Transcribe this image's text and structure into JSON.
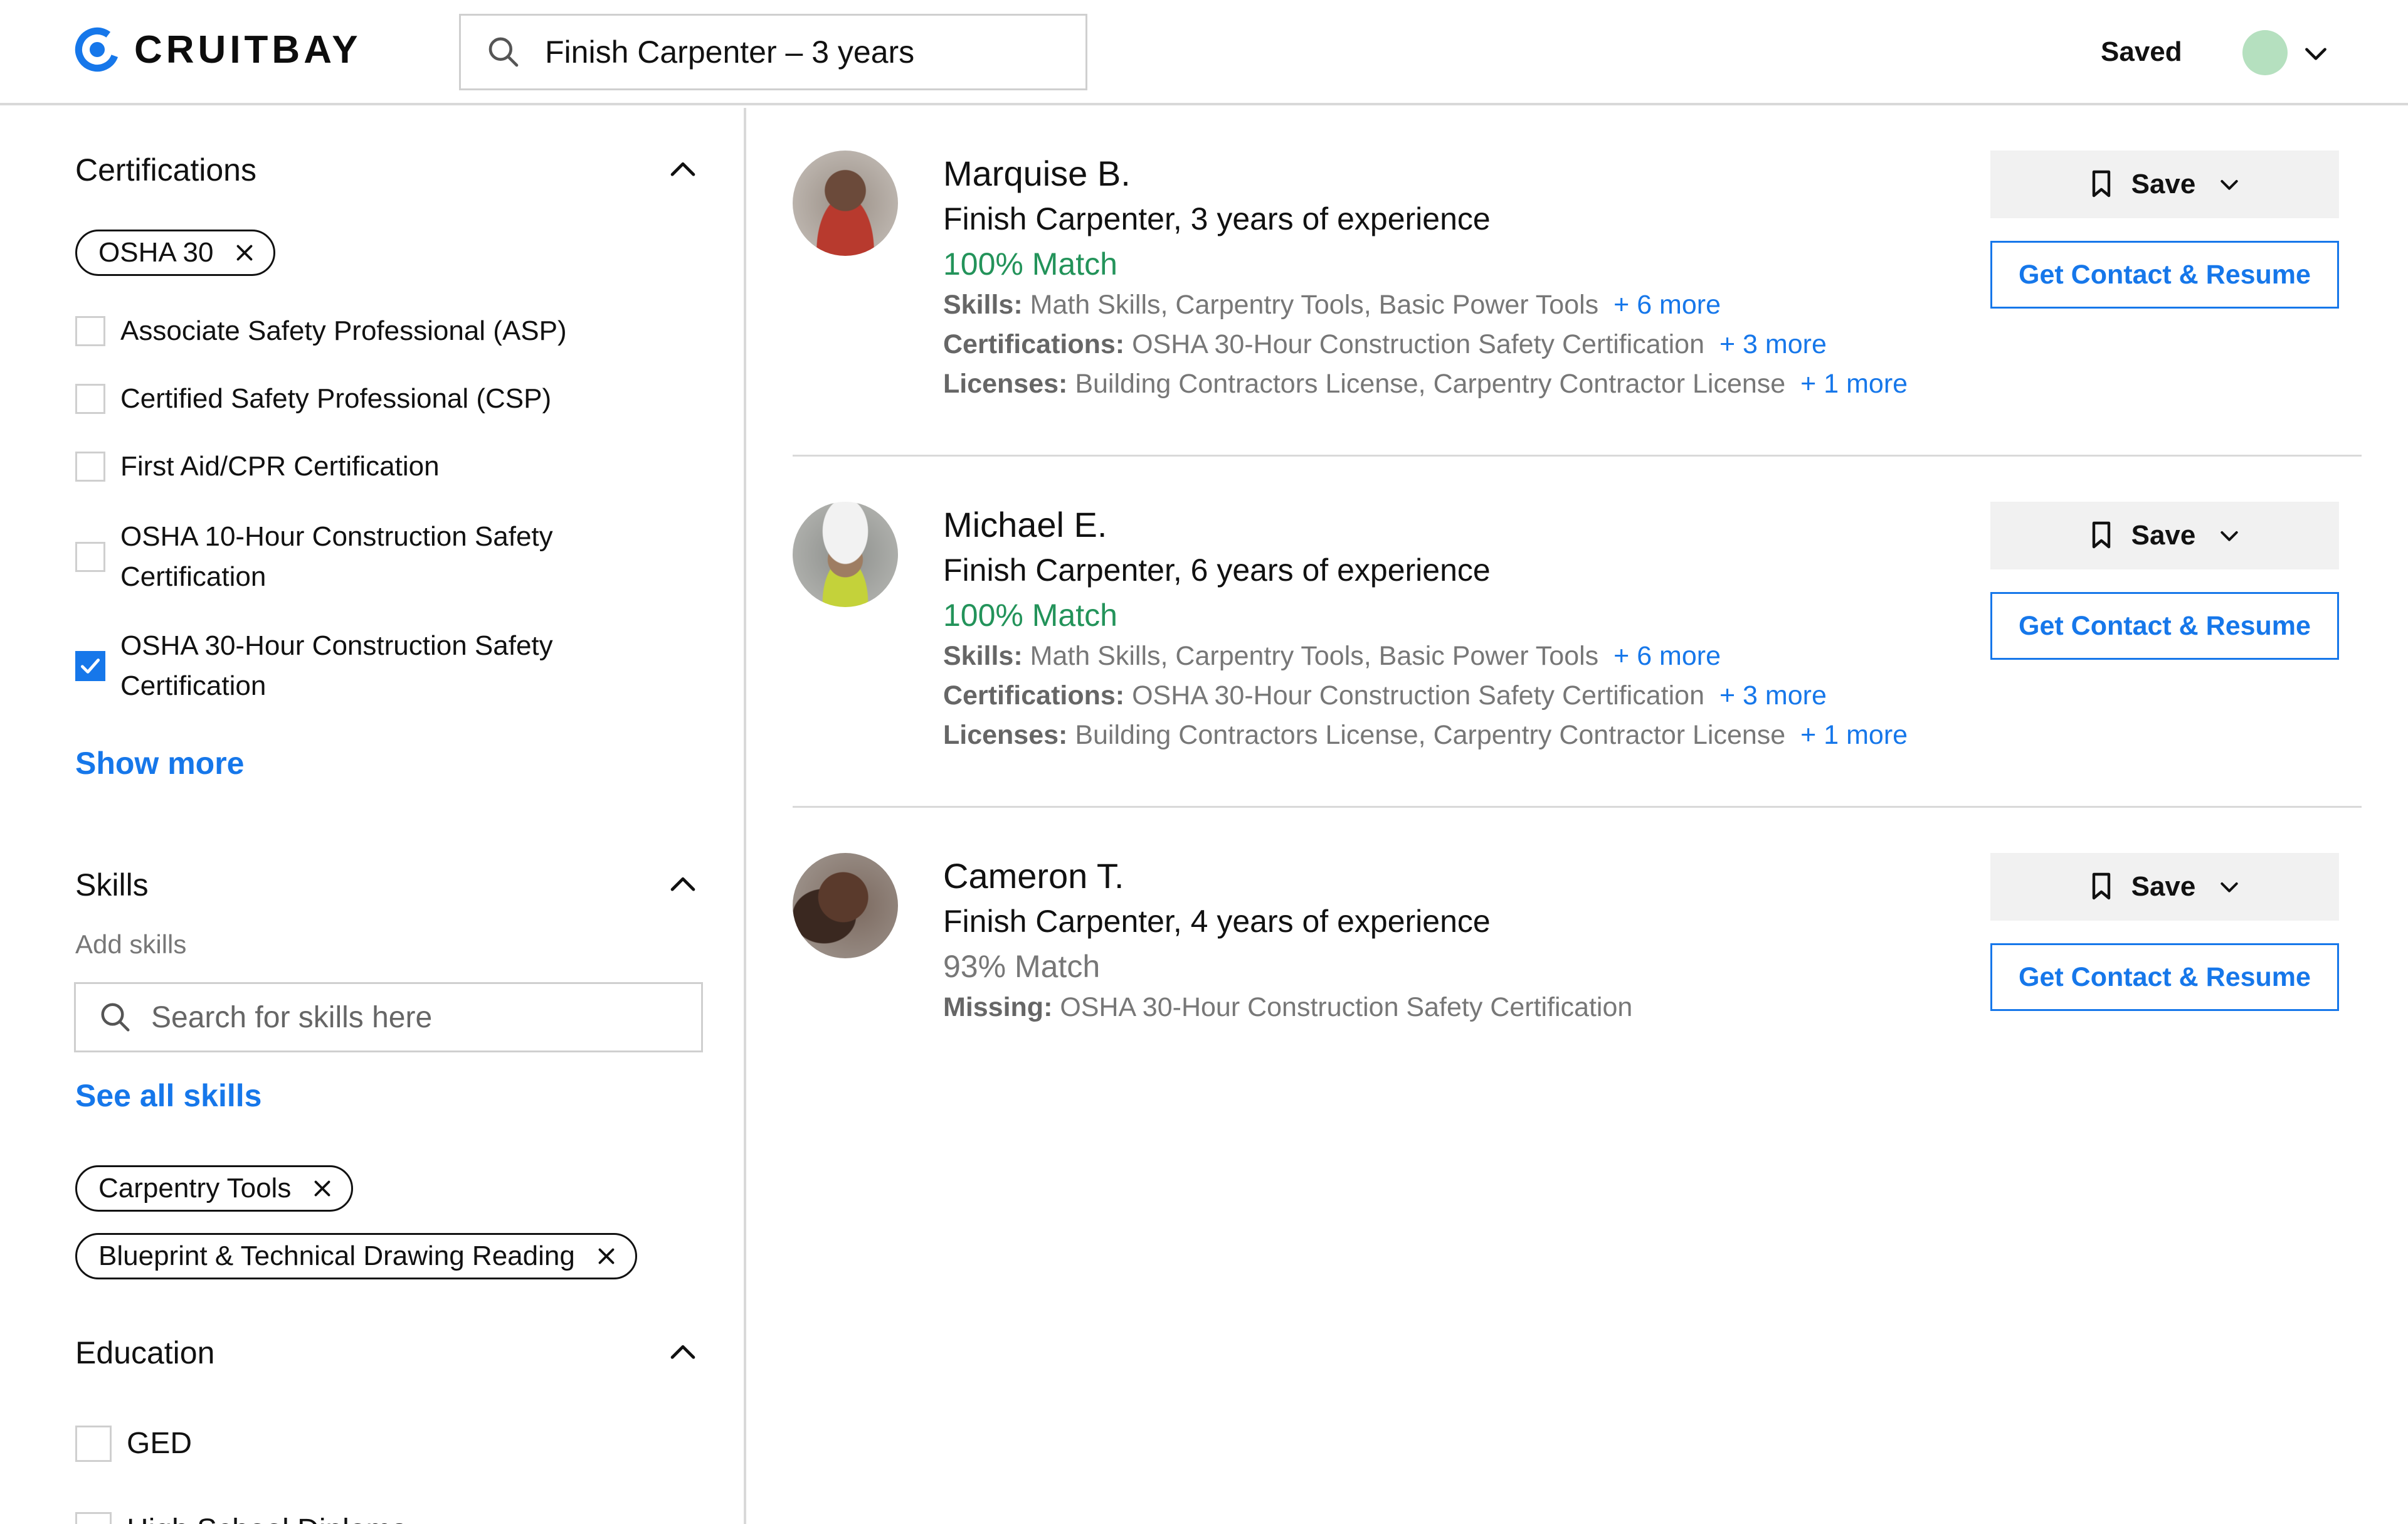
{
  "header": {
    "brand": "CRUITBAY",
    "search_value": "Finish Carpenter – 3 years",
    "saved_label": "Saved",
    "avatar_color": "#b5e0bf"
  },
  "sidebar": {
    "certifications": {
      "title": "Certifications",
      "chips": [
        "OSHA 30"
      ],
      "options": [
        {
          "label": "Associate Safety Professional (ASP)",
          "checked": false
        },
        {
          "label": "Certified Safety Professional (CSP)",
          "checked": false
        },
        {
          "label": "First Aid/CPR Certification",
          "checked": false
        },
        {
          "label": "OSHA 10-Hour Construction Safety Certification",
          "checked": false
        },
        {
          "label": "OSHA 30-Hour Construction Safety Certification",
          "checked": true
        }
      ],
      "show_more": "Show more"
    },
    "skills": {
      "title": "Skills",
      "add_label": "Add skills",
      "search_placeholder": "Search for skills here",
      "see_all": "See all skills",
      "chips": [
        "Carpentry Tools",
        "Blueprint & Technical Drawing Reading"
      ]
    },
    "education": {
      "title": "Education",
      "options": [
        {
          "label": "GED",
          "checked": false
        },
        {
          "label": "High School Diploma",
          "checked": false
        }
      ]
    }
  },
  "results": [
    {
      "name": "Marquise B.",
      "role": "Finish Carpenter, 3 years of experience",
      "match": "100% Match",
      "skills_label": "Skills:",
      "skills": "Math Skills, Carpentry Tools, Basic Power Tools",
      "skills_more": "+ 6 more",
      "certs_label": "Certifications:",
      "certs": "OSHA 30-Hour Construction Safety Certification",
      "certs_more": "+ 3 more",
      "licenses_label": "Licenses:",
      "licenses": "Building Contractors License, Carpentry Contractor License",
      "licenses_more": "+ 1 more",
      "save_label": "Save",
      "contact_label": "Get Contact & Resume"
    },
    {
      "name": "Michael E.",
      "role": "Finish Carpenter, 6 years of experience",
      "match": "100% Match",
      "skills_label": "Skills:",
      "skills": "Math Skills, Carpentry Tools, Basic Power Tools",
      "skills_more": "+ 6 more",
      "certs_label": "Certifications:",
      "certs": "OSHA 30-Hour Construction Safety Certification",
      "certs_more": "+ 3 more",
      "licenses_label": "Licenses:",
      "licenses": "Building Contractors License, Carpentry Contractor License",
      "licenses_more": "+ 1 more",
      "save_label": "Save",
      "contact_label": "Get Contact & Resume"
    },
    {
      "name": "Cameron T.",
      "role": "Finish Carpenter, 4 years of experience",
      "match": "93% Match",
      "missing_label": "Missing:",
      "missing": "OSHA 30-Hour Construction Safety Certification",
      "save_label": "Save",
      "contact_label": "Get Contact & Resume"
    }
  ],
  "colors": {
    "accent": "#1677ea",
    "match_full": "#23935a",
    "muted": "#777777"
  }
}
